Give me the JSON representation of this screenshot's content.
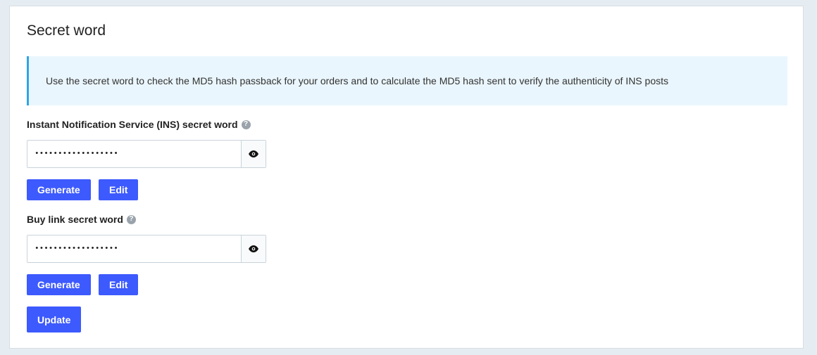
{
  "card": {
    "title": "Secret word"
  },
  "info": {
    "text": "Use the secret word to check the MD5 hash passback for your orders and to calculate the MD5 hash sent to verify the authenticity of INS posts"
  },
  "ins": {
    "label": "Instant Notification Service (INS) secret word",
    "value": "******************",
    "generate_label": "Generate",
    "edit_label": "Edit"
  },
  "buylink": {
    "label": "Buy link secret word",
    "value": "******************",
    "generate_label": "Generate",
    "edit_label": "Edit"
  },
  "update_label": "Update",
  "icons": {
    "help": "help-icon",
    "reveal": "eye-icon"
  },
  "colors": {
    "primary": "#3d5afe",
    "info_bg": "#eaf6fd",
    "info_border": "#2fa4e7"
  }
}
